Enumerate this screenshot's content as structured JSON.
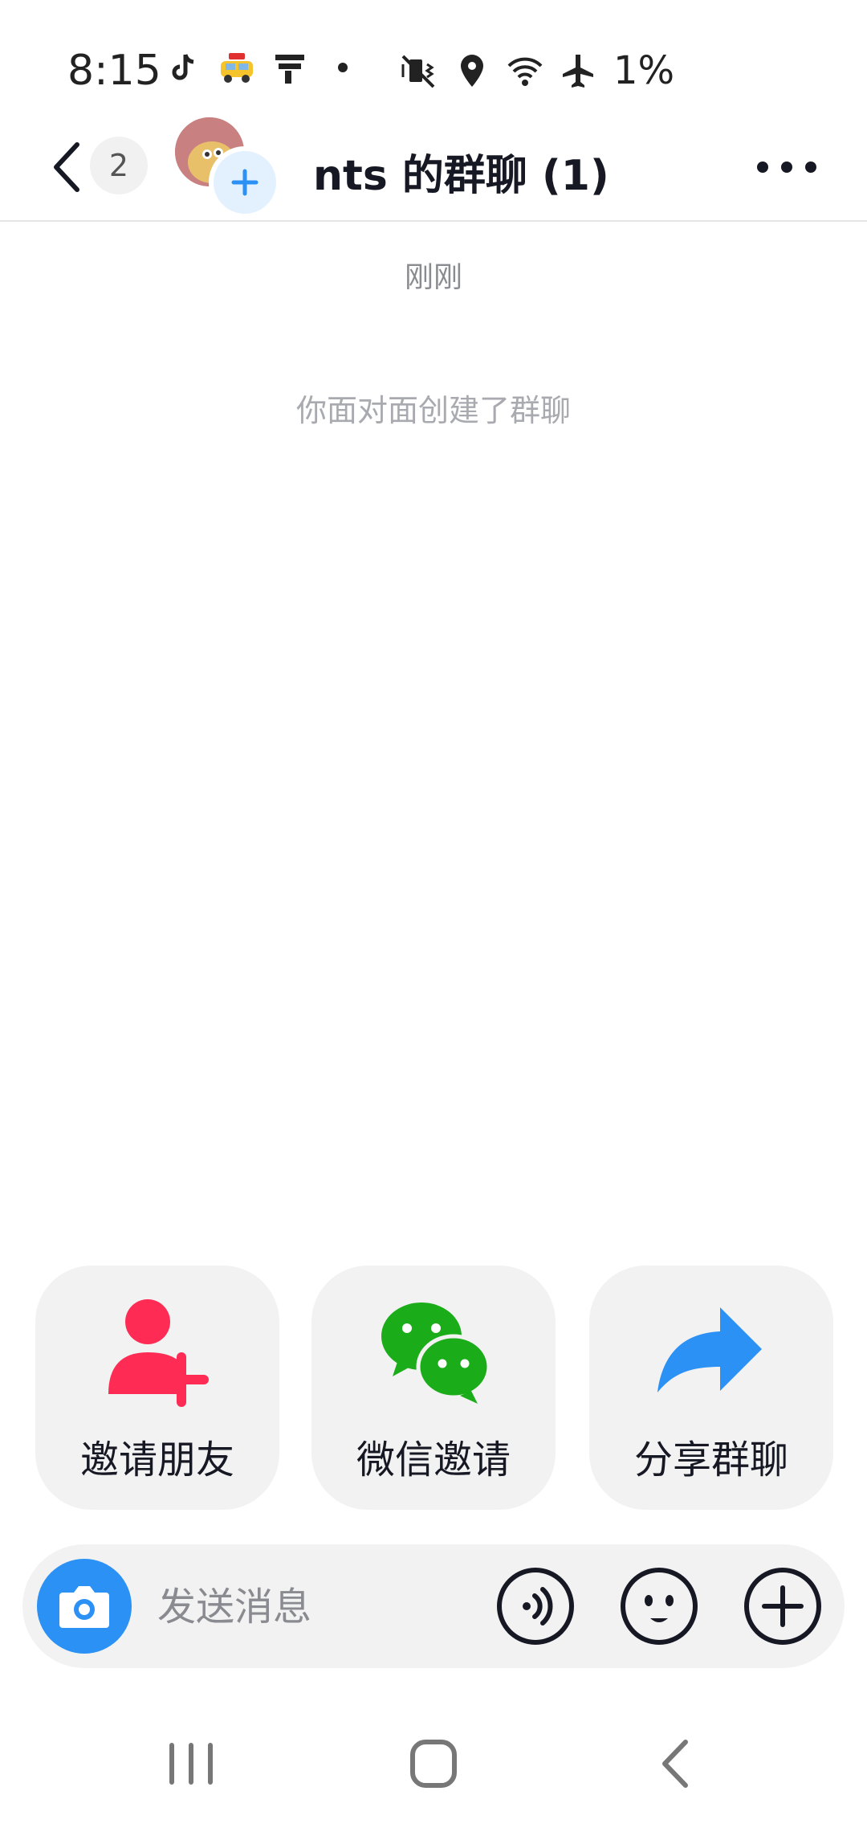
{
  "status_bar": {
    "time": "8:15",
    "battery": "1%",
    "icons": [
      "tiktok-icon",
      "taxi-emoji-icon",
      "notification-app-icon",
      "dot-icon",
      "mute-vibrate-icon",
      "location-icon",
      "wifi-icon",
      "airplane-icon"
    ]
  },
  "header": {
    "unread_count": "2",
    "title": "nts 的群聊 (1)"
  },
  "chat": {
    "time_label": "刚刚",
    "system_message": "你面对面创建了群聊"
  },
  "actions": [
    {
      "label": "邀请朋友",
      "icon": "add-friend-icon"
    },
    {
      "label": "微信邀请",
      "icon": "wechat-icon"
    },
    {
      "label": "分享群聊",
      "icon": "share-icon"
    }
  ],
  "input": {
    "placeholder": "发送消息"
  },
  "colors": {
    "accent_blue": "#2B91F5",
    "invite_red": "#FE2C55",
    "wechat_green": "#1AAD19",
    "card_bg": "#F2F2F2"
  }
}
